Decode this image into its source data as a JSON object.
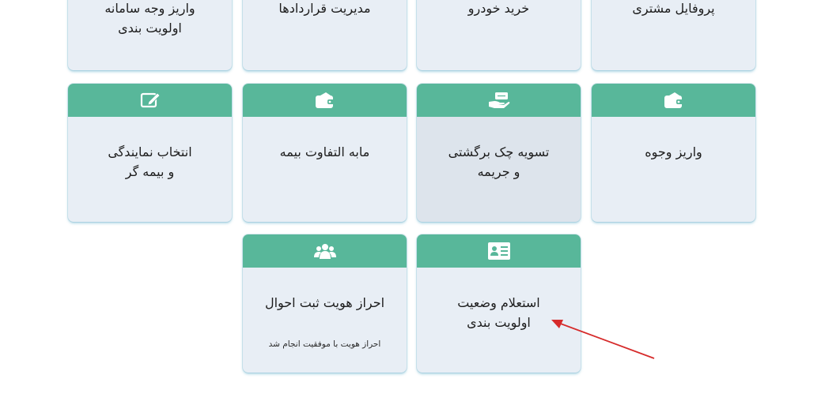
{
  "top_row": [
    {
      "key": "deposit-system",
      "title": "واریز وجه سامانه\nاولویت بندی"
    },
    {
      "key": "contracts",
      "title": "مدیریت قراردادها"
    },
    {
      "key": "car-purchase",
      "title": "خرید خودرو"
    },
    {
      "key": "customer-profile",
      "title": "پروفایل مشتری"
    }
  ],
  "middle_row": [
    {
      "key": "agency-insurer",
      "title": "انتخاب نمایندگی\nو بیمه گر",
      "icon": "edit-icon"
    },
    {
      "key": "insurance-difference",
      "title": "مابه التفاوت بیمه",
      "icon": "wallet-icon"
    },
    {
      "key": "bounced-check",
      "title": "تسویه چک برگشتی\nو جریمه",
      "icon": "hand-money-icon"
    },
    {
      "key": "deposit-funds",
      "title": "واریز وجوه",
      "icon": "wallet-icon"
    }
  ],
  "bottom_row": [
    {
      "key": "identity-verification",
      "title": "احراز هویت ثبت احوال",
      "subtitle": "احراز هویت با موفقیت انجام شد",
      "icon": "users-icon"
    },
    {
      "key": "priority-status",
      "title": "استعلام وضعیت\nاولویت بندی",
      "icon": "id-card-icon"
    }
  ],
  "colors": {
    "header_green": "#58b79a",
    "card_bg": "#e8eef5",
    "card_hover_bg": "#dde4ec",
    "annotation_arrow": "#d62b2b"
  }
}
